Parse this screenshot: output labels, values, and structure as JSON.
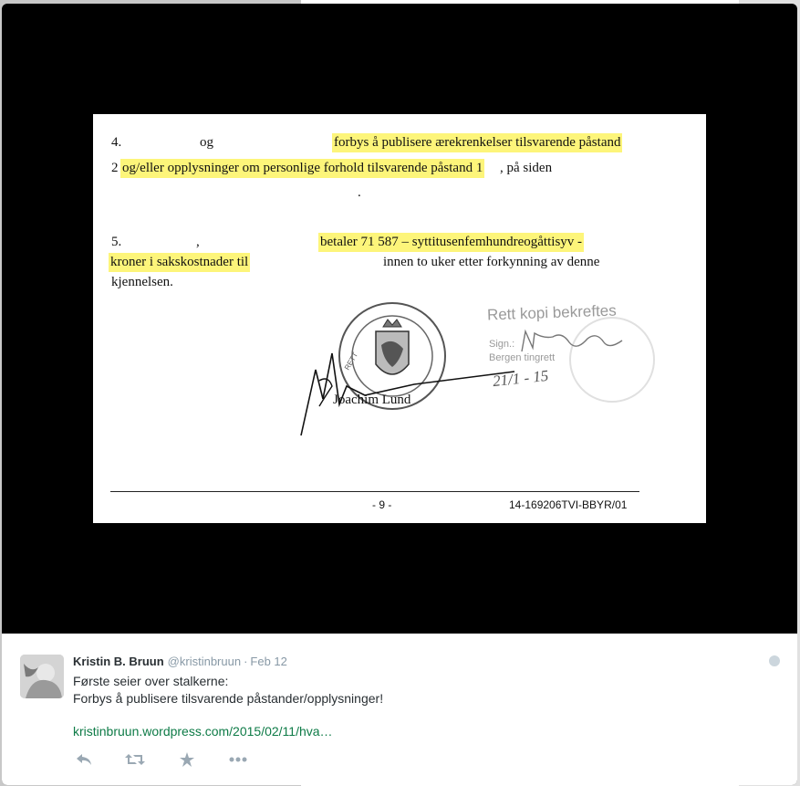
{
  "document": {
    "l4_num": "4.",
    "l4_og": "og",
    "l4_hl": "forbys å publisere ærekrenkelser tilsvarende påstand",
    "l2_prefix": "2",
    "l2_hl": "og/eller opplysninger om personlige forhold tilsvarende påstand 1",
    "l2_suffix": ", på siden",
    "dot": ".",
    "l5_num": "5.",
    "l5_comma": ",",
    "l5_hl": "betaler 71 587 – syttitusenfemhundreogåttisyv -",
    "kroner_hl": "kroner i sakskostnader til",
    "kroner_rest": "innen to uker etter forkynning av denne",
    "kjennelsen": "kjennelsen.",
    "stamp_title": "Rett kopi bekreftes",
    "stamp_sign": "Sign.:",
    "stamp_court": "Bergen tingrett",
    "stamp_date": "21/1 - 15",
    "judge": "Joachim Lund",
    "page": "- 9 -",
    "case_no": "14-169206TVI-BBYR/01"
  },
  "tweet": {
    "name": "Kristin B. Bruun",
    "handle": "@kristinbruun",
    "sep": "·",
    "time": "Feb 12",
    "text": "Første seier over stalkerne:\nForbys å publisere tilsvarende påstander/opplysninger!",
    "link": "kristinbruun.wordpress.com/2015/02/11/hva…"
  },
  "icons": {
    "reply": "reply-icon",
    "retweet": "retweet-icon",
    "favorite": "star-icon",
    "more": "more-icon",
    "globe": "globe-icon"
  },
  "colors": {
    "highlight": "#fdf57a",
    "link": "#0e7b47",
    "muted": "#8899a6"
  }
}
